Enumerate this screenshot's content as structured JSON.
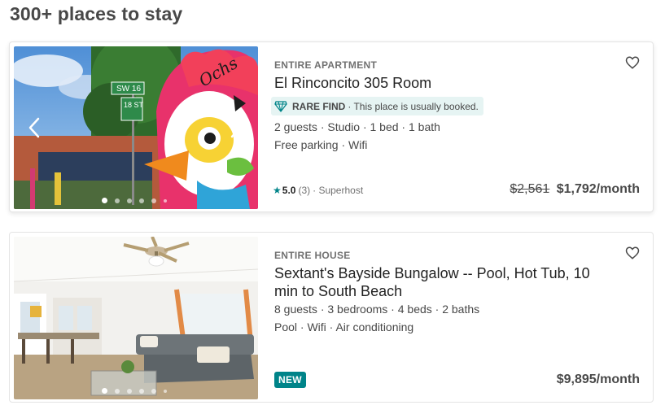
{
  "page": {
    "title": "300+ places to stay"
  },
  "listings": [
    {
      "type": "ENTIRE APARTMENT",
      "title": "El Rinconcito 305 Room",
      "rare_find": {
        "strong": "RARE FIND",
        "text": "· This place is usually booked."
      },
      "details": "2 guests · Studio · 1 bed · 1 bath",
      "amenities": "Free parking · Wifi",
      "rating": {
        "score": "5.0",
        "count": "(3)",
        "host": "· Superhost"
      },
      "price": {
        "original": "$2,561",
        "current": "$1,792/month"
      },
      "photo_dots": 5
    },
    {
      "type": "ENTIRE HOUSE",
      "title": "Sextant's Bayside Bungalow -- Pool, Hot Tub, 10 min to South Beach",
      "details": "8 guests · 3 bedrooms · 4 beds · 2 baths",
      "amenities": "Pool · Wifi · Air conditioning",
      "badge": "NEW",
      "price": {
        "current": "$9,895/month"
      },
      "photo_dots": 5
    }
  ],
  "icons": {
    "heart": "heart-outline-icon",
    "rare_find": "diamond-icon",
    "star": "star-icon",
    "prev": "chevron-left-icon",
    "next": "chevron-right-icon"
  },
  "colors": {
    "accent": "#008489",
    "text": "#484848",
    "rare_bg": "#e6f4f3"
  }
}
